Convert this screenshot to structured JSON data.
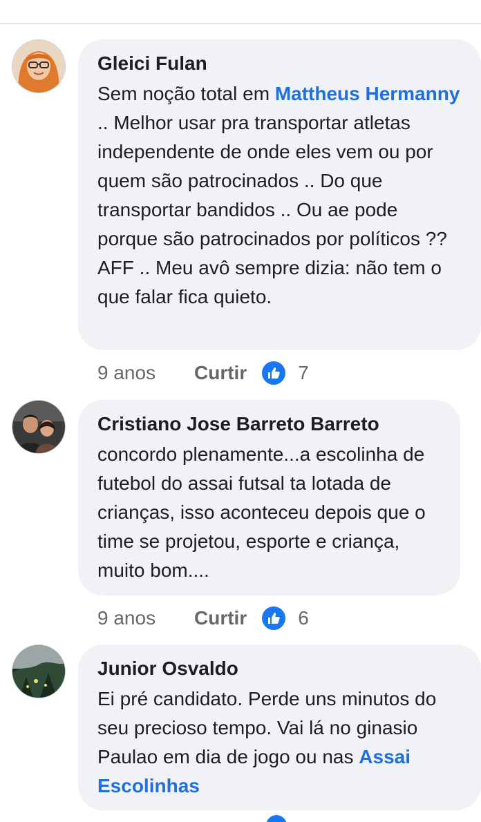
{
  "comments": [
    {
      "author": "Gleici Fulan",
      "text_before": "Sem noção total em ",
      "mention": "Mattheus Hermanny",
      "text_after": " .. Melhor usar pra transportar atletas independente de onde eles vem ou por quem são patrocinados .. Do que transportar bandidos .. Ou ae pode porque são patrocinados por políticos ??\nAFF .. Meu avô sempre dizia: não tem o que falar fica quieto.",
      "time": "9 anos",
      "like_label": "Curtir",
      "reactions": "7",
      "reaction_icon": "thumbs-up-icon"
    },
    {
      "author": "Cristiano Jose Barreto Barreto",
      "text": "concordo plenamente...a escolinha de futebol do assai futsal ta lotada de crianças, isso aconteceu depois que o time se projetou, esporte e criança, muito bom....",
      "time": "9 anos",
      "like_label": "Curtir",
      "reactions": "6",
      "reaction_icon": "thumbs-up-icon"
    },
    {
      "author": "Junior Osvaldo",
      "text_before": "Ei pré candidato. Perde uns minutos do seu precioso tempo. Vai lá no ginasio Paulao em dia de jogo ou nas ",
      "mention": "Assai Escolinhas",
      "text_after": ""
    }
  ],
  "colors": {
    "bubble": "#f0f2f5",
    "mention": "#216fdb",
    "like_badge": "#1877f2",
    "meta_text": "#65676b"
  }
}
